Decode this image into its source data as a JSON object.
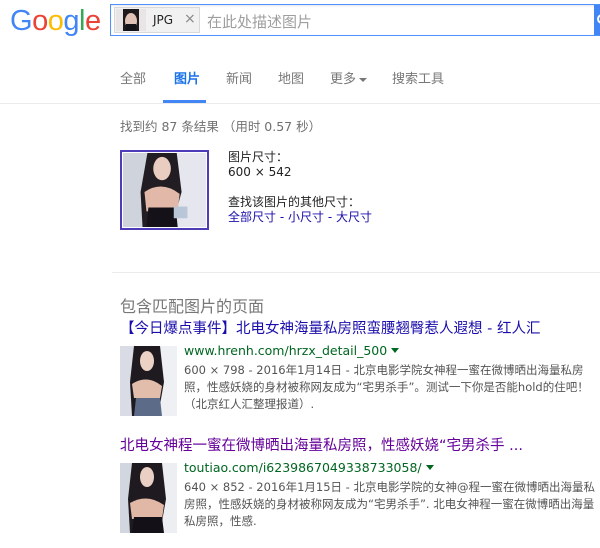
{
  "logo": {
    "text": "Google",
    "letters": [
      "G",
      "o",
      "o",
      "g",
      "l",
      "e"
    ],
    "colors": [
      "#4285f4",
      "#ea4335",
      "#fbbc05",
      "#4285f4",
      "#34a853",
      "#ea4335"
    ]
  },
  "search": {
    "chip_label": "JPG",
    "chip_close": "×",
    "placeholder": "在此处描述图片"
  },
  "tabs": [
    {
      "label": "全部",
      "active": false
    },
    {
      "label": "图片",
      "active": true
    },
    {
      "label": "新闻",
      "active": false
    },
    {
      "label": "地图",
      "active": false
    },
    {
      "label": "更多",
      "active": false
    },
    {
      "label": "搜索工具",
      "active": false
    }
  ],
  "result_stats": "找到约 87 条结果 （用时 0.57 秒）",
  "image_info": {
    "size_label": "图片尺寸：",
    "size_value": "600 × 542",
    "other_sizes_label": "查找该图片的其他尺寸：",
    "links": [
      "全部尺寸",
      "小尺寸",
      "大尺寸"
    ],
    "separator": " - "
  },
  "section_title": "包含匹配图片的页面",
  "results": [
    {
      "title": "【今日爆点事件】北电女神海量私房照蛮腰翘臀惹人遐想 - 红人汇",
      "url": "www.hrenh.com/hrzx_detail_500",
      "snippet": "600 × 798 - 2016年1月14日 - 北京电影学院女神程一蜜在微博晒出海量私房照，性感妖娆的身材被称网友成为“宅男杀手”。测试一下你是否能hold的住吧！（北京红人汇整理报道）."
    },
    {
      "title": "北电女神程一蜜在微博晒出海量私房照，性感妖娆“宅男杀手 ...",
      "url": "toutiao.com/i6239867049338733058/",
      "snippet": "640 × 852 - 2016年1月15日 - 北京电影学院的女神@程一蜜在微博晒出海量私房照，性感妖娆的身材被称网友成为“宅男杀手”. 北电女神程一蜜在微博晒出海量私房照，性感."
    }
  ]
}
